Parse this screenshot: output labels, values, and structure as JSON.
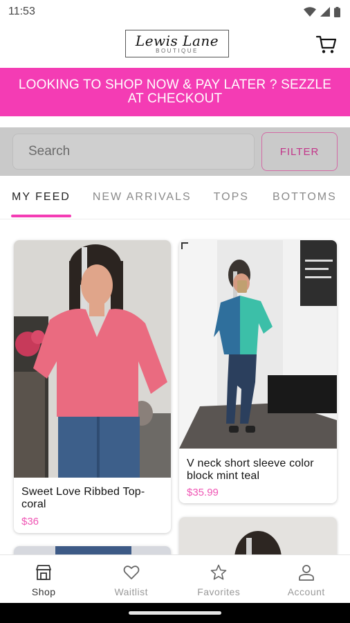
{
  "status_bar": {
    "time": "11:53",
    "icons": [
      "wifi-icon",
      "signal-icon",
      "battery-icon"
    ]
  },
  "header": {
    "logo_main": "Lewis Lane",
    "logo_sub": "BOUTIQUE",
    "cart_icon": "cart-icon"
  },
  "promo": {
    "text": "LOOKING TO SHOP NOW & PAY LATER ? SEZZLE AT CHECKOUT",
    "background": "#f43cb4"
  },
  "search": {
    "placeholder": "Search",
    "filter_label": "FILTER"
  },
  "tabs": [
    {
      "label": "MY FEED",
      "active": true
    },
    {
      "label": "NEW ARRIVALS",
      "active": false
    },
    {
      "label": "TOPS",
      "active": false
    },
    {
      "label": "BOTTOMS",
      "active": false
    }
  ],
  "products": [
    {
      "title": "Sweet Love Ribbed Top-coral",
      "price": "$36"
    },
    {
      "title": "V neck short sleeve color block mint teal",
      "price": "$35.99"
    }
  ],
  "bottom_nav": [
    {
      "label": "Shop",
      "icon": "shop-icon",
      "active": true
    },
    {
      "label": "Waitlist",
      "icon": "heart-icon",
      "active": false
    },
    {
      "label": "Favorites",
      "icon": "star-icon",
      "active": false
    },
    {
      "label": "Account",
      "icon": "person-icon",
      "active": false
    }
  ],
  "colors": {
    "accent": "#f43cb4",
    "price": "#ef55b4"
  }
}
